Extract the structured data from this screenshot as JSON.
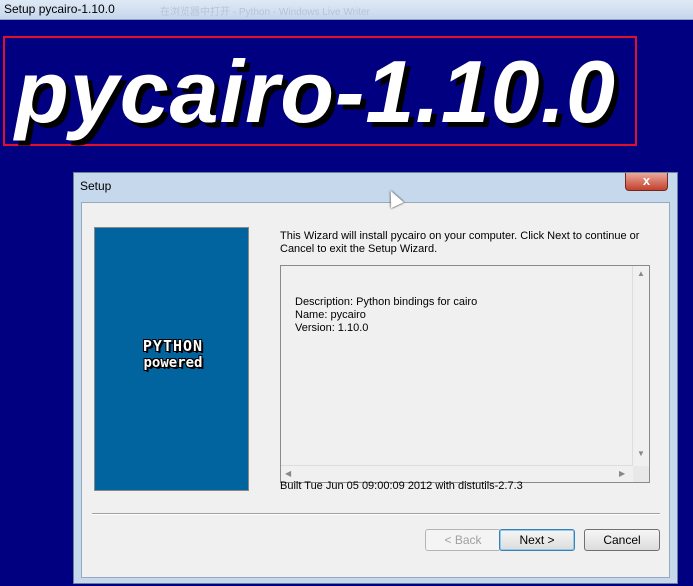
{
  "window": {
    "title": "Setup pycairo-1.10.0",
    "ghost_text": "在浏览器中打开 - Python - Windows Live Writer"
  },
  "banner": {
    "text": "pycairo-1.10.0",
    "border_color": "#e0102a"
  },
  "dialog": {
    "title": "Setup",
    "close_glyph": "x",
    "logo": {
      "line1": "PYTHON",
      "line2": "powered"
    },
    "intro": "This Wizard will install pycairo on your computer. Click Next to continue or Cancel to exit the Setup Wizard.",
    "description": {
      "line1": "Description: Python bindings for cairo",
      "line2": "Name: pycairo",
      "line3": "Version: 1.10.0"
    },
    "built": "Built Tue Jun 05 09:00:09 2012 with distutils-2.7.3",
    "buttons": {
      "back": "< Back",
      "next": "Next >",
      "cancel": "Cancel"
    }
  },
  "colors": {
    "background": "#000080",
    "sidebar": "#02649e"
  }
}
